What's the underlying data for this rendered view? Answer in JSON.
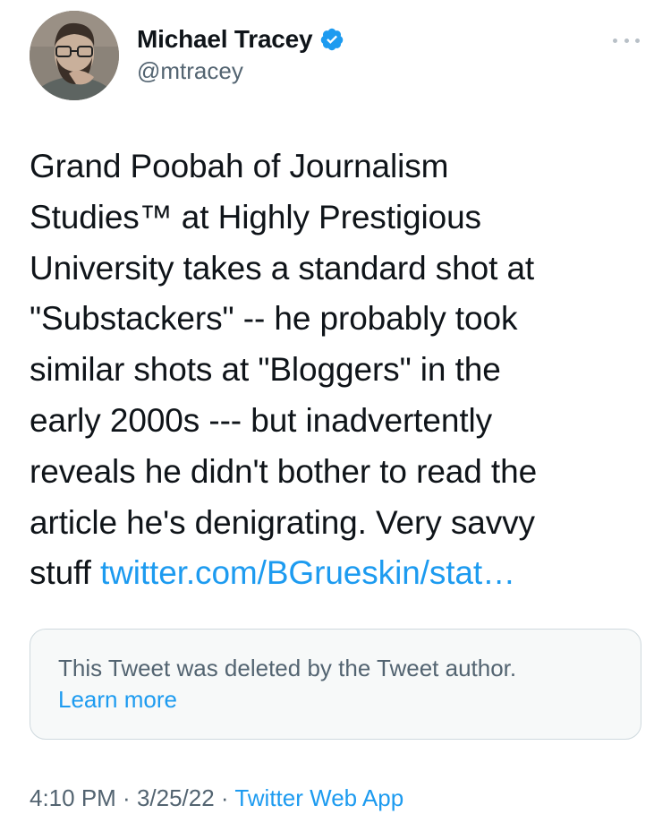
{
  "author": {
    "display_name": "Michael Tracey",
    "handle": "@mtracey",
    "verified_icon": "verified-badge-icon",
    "avatar_icon": "avatar-photo"
  },
  "tweet": {
    "text_lines": [
      "Grand Poobah of Journalism",
      "Studies™ at Highly Prestigious",
      "University takes a standard shot at",
      "\"Substackers\" -- he probably took",
      "similar shots at \"Bloggers\" in the",
      "early 2000s --- but inadvertently",
      "reveals he didn't bother to read the",
      "article he's denigrating. Very savvy"
    ],
    "last_line_prefix": "stuff ",
    "link_text": "twitter.com/BGrueskin/stat…"
  },
  "quote": {
    "message": "This Tweet was deleted by the Tweet author.",
    "learn_more": "Learn more"
  },
  "meta": {
    "time": "4:10 PM",
    "separator1": " · ",
    "date": "3/25/22",
    "separator2": " · ",
    "source": "Twitter Web App"
  },
  "colors": {
    "link": "#1d9bf0",
    "secondary_text": "#536471",
    "verified": "#1d9bf0"
  }
}
